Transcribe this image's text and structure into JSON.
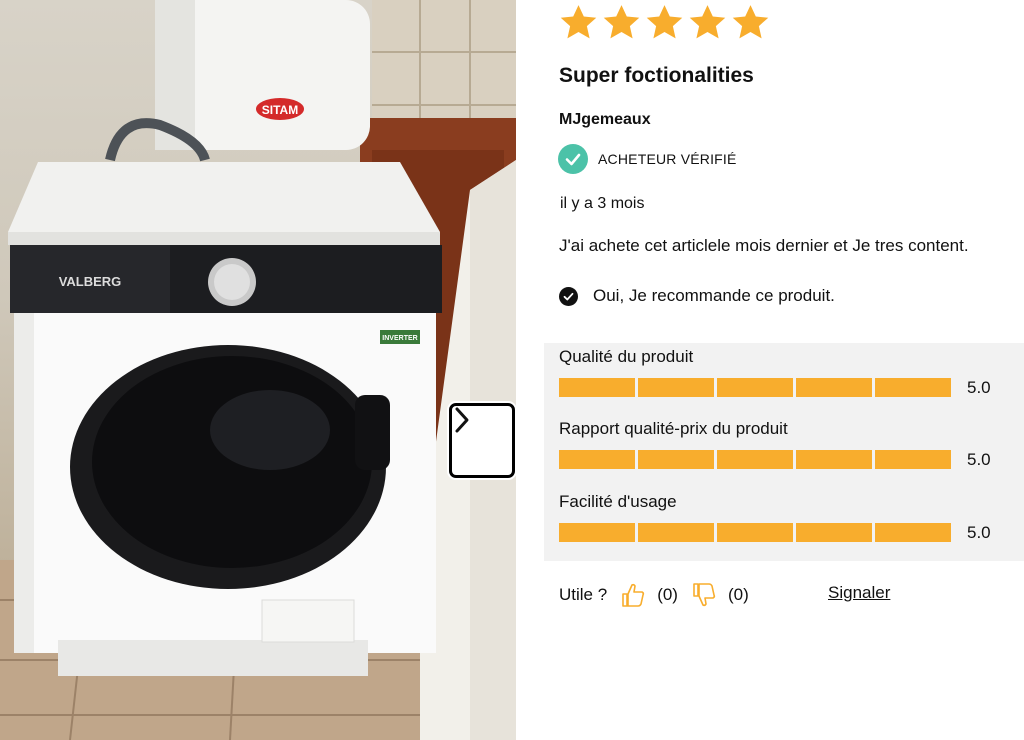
{
  "photo": {
    "brand_label": "VALBERG",
    "boiler_label": "SITAM",
    "badge_label": "INVERTER"
  },
  "gallery": {
    "next_icon": "chevron-right-icon"
  },
  "review": {
    "rating_stars": 5,
    "title": "Super foctionalities",
    "author": "MJgemeaux",
    "verified_label": "ACHETEUR VÉRIFIÉ",
    "date": "il y a 3 mois",
    "body": "J'ai achete cet articlele mois dernier et Je tres content.",
    "recommend_label": "Oui, Je recommande ce produit.",
    "criteria": [
      {
        "label": "Qualité du produit",
        "value": "5.0",
        "score": 5
      },
      {
        "label": "Rapport qualité-prix du produit",
        "value": "5.0",
        "score": 5
      },
      {
        "label": "Facilité d'usage",
        "value": "5.0",
        "score": 5
      }
    ],
    "helpful_label": "Utile ?",
    "helpful_yes_count": "(0)",
    "helpful_no_count": "(0)",
    "report_label": "Signaler"
  },
  "colors": {
    "star": "#f8ad2d",
    "bar": "#f8ad2d",
    "verified": "#4cc2a8",
    "ratings_bg": "#f2f2f2",
    "thumb": "#f8ad2d"
  }
}
